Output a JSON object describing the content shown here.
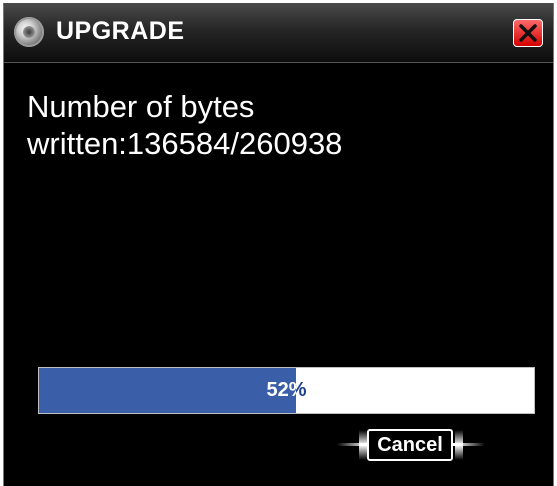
{
  "window": {
    "title": "UPGRADE",
    "icon": "disc-icon",
    "close_icon": "close-x-icon"
  },
  "message": {
    "line1": "Number of bytes",
    "line2": "written:136584/260938"
  },
  "progress": {
    "percent": 52,
    "label": "52%",
    "fill_color": "#3a5fa8"
  },
  "cancel_button": {
    "label": "Cancel"
  }
}
